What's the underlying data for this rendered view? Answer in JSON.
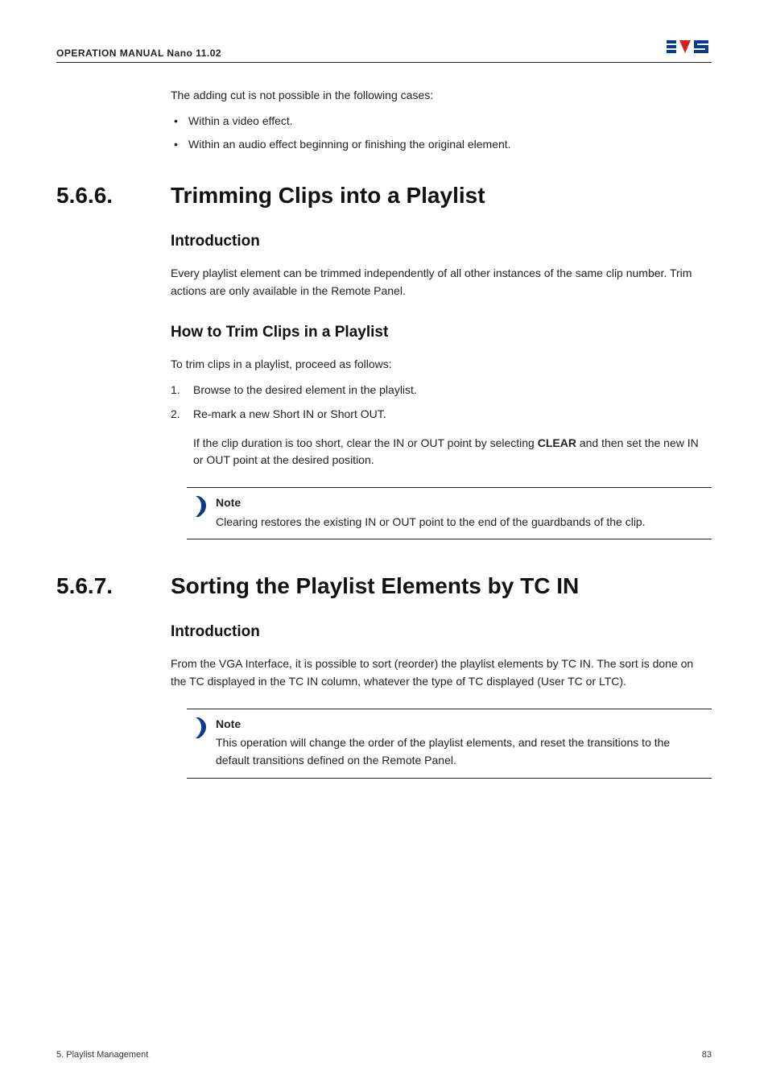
{
  "header": {
    "manual_title": "OPERATION MANUAL Nano 11.02"
  },
  "intro_before": {
    "lead": "The adding cut is not possible in the following cases:",
    "bullets": [
      "Within a video effect.",
      "Within an audio effect beginning or finishing the original element."
    ]
  },
  "section1": {
    "number": "5.6.6.",
    "title": "Trimming Clips into a Playlist",
    "intro_heading": "Introduction",
    "intro_para": "Every playlist element can be trimmed independently of all other instances of the same clip number. Trim actions are only available in the Remote Panel.",
    "howto_heading": "How to Trim Clips in a Playlist",
    "howto_lead": "To trim clips in a playlist, proceed as follows:",
    "steps": [
      "Browse to the desired element in the playlist.",
      "Re-mark a new Short IN or Short OUT."
    ],
    "step_sub_prefix": "If the clip duration is too short, clear the IN or OUT point by selecting ",
    "step_sub_bold": "CLEAR",
    "step_sub_suffix": " and then set the new IN or OUT point at the desired position.",
    "note_title": "Note",
    "note_body": "Clearing restores the existing IN or OUT point to the end of the guardbands of the clip."
  },
  "section2": {
    "number": "5.6.7.",
    "title": "Sorting the Playlist Elements by TC IN",
    "intro_heading": "Introduction",
    "intro_para": "From the VGA Interface, it is possible to sort (reorder) the playlist elements by TC IN. The sort is done on the TC displayed in the TC IN column, whatever the type of TC displayed (User TC or LTC).",
    "note_title": "Note",
    "note_body": "This operation will change the order of the playlist elements, and reset the transitions to the default transitions defined on the Remote Panel."
  },
  "footer": {
    "left": "5. Playlist Management",
    "right": "83"
  }
}
